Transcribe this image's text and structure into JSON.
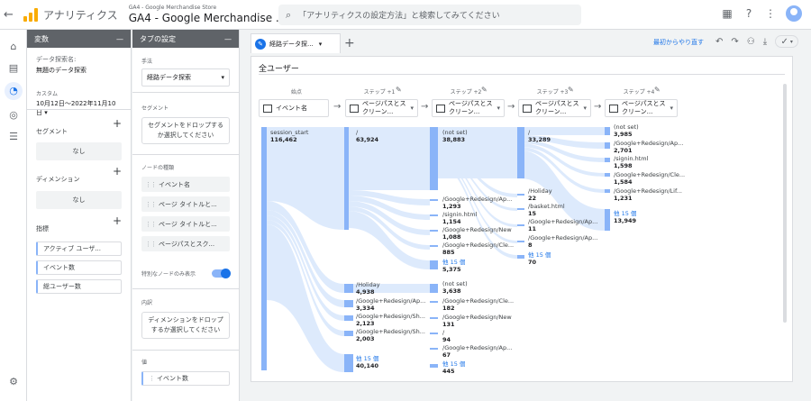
{
  "topbar": {
    "app_name": "アナリティクス",
    "account": "GA4 - Google Merchandise Store",
    "property": "GA4 - Google Merchandise ...",
    "search_placeholder": "「アナリティクスの設定方法」と検索してみてください"
  },
  "variables_panel": {
    "header": "変数",
    "exploration_name_label": "データ探索名:",
    "exploration_name": "無題のデータ探索",
    "date_label": "カスタム",
    "date_range": "10月12日～2022年11月10日",
    "segments_title": "セグメント",
    "segments_empty": "なし",
    "dimensions_title": "ディメンション",
    "dimensions_empty": "なし",
    "metrics_title": "指標",
    "metrics": [
      "アクティブ ユーザ...",
      "イベント数",
      "総ユーザー数"
    ]
  },
  "tab_settings": {
    "header": "タブの設定",
    "technique_label": "手法",
    "technique_value": "経路データ探索",
    "segment_label": "セグメント",
    "segment_drop": "セグメントをドロップするか選択してください",
    "node_type_label": "ノードの種類",
    "node_types": [
      "イベント名",
      "ページ タイトルと...",
      "ページ タイトルと...",
      "ページパスとスク..."
    ],
    "special_nodes_label": "特別なノードのみ表示",
    "breakdown_label": "内訳",
    "breakdown_drop": "ディメンションをドロップするか選択してください",
    "values_label": "値",
    "values_item": "イベント数"
  },
  "canvas": {
    "tab_label": "経路データ探...",
    "restart_label": "最初からやり直す",
    "segment_title": "全ユーザー",
    "start_caption": "始点",
    "start_node": "イベント名",
    "steps": [
      {
        "caption": "ステップ +1",
        "select": "ページパスとスクリーン..."
      },
      {
        "caption": "ステップ +2",
        "select": "ページパスとスクリーン..."
      },
      {
        "caption": "ステップ +3",
        "select": "ページパスとスクリーン..."
      },
      {
        "caption": "ステップ +4",
        "select": "ページパスとスクリーン..."
      }
    ],
    "col0": [
      {
        "label": "session_start",
        "value": "116,462"
      }
    ],
    "col1": [
      {
        "label": "/",
        "value": "63,924"
      },
      {
        "label": "/Holiday",
        "value": "4,938"
      },
      {
        "label": "/Google+Redesign/Ap...",
        "value": "3,334"
      },
      {
        "label": "/Google+Redesign/Sh...",
        "value": "2,123"
      },
      {
        "label": "/Google+Redesign/Sh...",
        "value": "2,003"
      },
      {
        "label": "他 15 個",
        "value": "40,140"
      }
    ],
    "col2": [
      {
        "label": "(not set)",
        "value": "38,883"
      },
      {
        "label": "/Google+Redesign/Ap...",
        "value": "1,293"
      },
      {
        "label": "/signin.html",
        "value": "1,154"
      },
      {
        "label": "/Google+Redesign/New",
        "value": "1,088"
      },
      {
        "label": "/Google+Redesign/Cle...",
        "value": "885"
      },
      {
        "label": "他 15 個",
        "value": "5,375"
      },
      {
        "label": "(not set)",
        "value": "3,638"
      },
      {
        "label": "/Google+Redesign/Cle...",
        "value": "182"
      },
      {
        "label": "/Google+Redesign/New",
        "value": "131"
      },
      {
        "label": "/",
        "value": "94"
      },
      {
        "label": "/Google+Redesign/Ap...",
        "value": "67"
      },
      {
        "label": "他 15 個",
        "value": "445"
      }
    ],
    "col3": [
      {
        "label": "/",
        "value": "33,289"
      },
      {
        "label": "/Holiday",
        "value": "22"
      },
      {
        "label": "/basket.html",
        "value": "15"
      },
      {
        "label": "/Google+Redesign/Ap...",
        "value": "11"
      },
      {
        "label": "/Google+Redesign/Ap...",
        "value": "8"
      },
      {
        "label": "他 15 個",
        "value": "70"
      }
    ],
    "col4": [
      {
        "label": "(not set)",
        "value": "3,985"
      },
      {
        "label": "/Google+Redesign/Ap...",
        "value": "2,701"
      },
      {
        "label": "/signin.html",
        "value": "1,598"
      },
      {
        "label": "/Google+Redesign/Cle...",
        "value": "1,584"
      },
      {
        "label": "/Google+Redesign/Lif...",
        "value": "1,231"
      },
      {
        "label": "他 15 個",
        "value": "13,949"
      }
    ]
  }
}
